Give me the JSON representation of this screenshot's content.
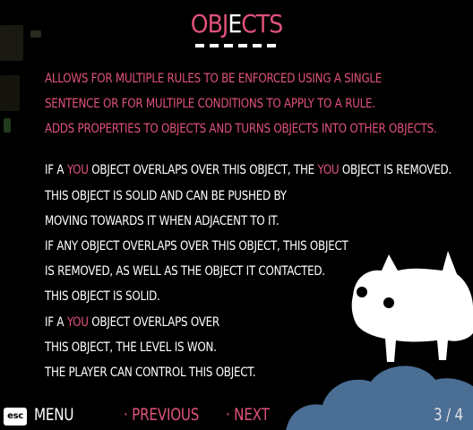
{
  "title": {
    "left": "OBJ",
    "highlight": "E",
    "right": "CTS"
  },
  "intro_lines": [
    "ALLOWS FOR MULTIPLE RULES TO BE ENFORCED USING A SINGLE",
    "SENTENCE OR FOR MULTIPLE CONDITIONS TO APPLY TO A RULE.",
    "ADDS PROPERTIES TO OBJECTS AND TURNS OBJECTS INTO OTHER OBJECTS."
  ],
  "descriptions": {
    "l1a": "IF A ",
    "l1b": "YOU",
    "l1c": " OBJECT OVERLAPS OVER THIS OBJECT, THE ",
    "l1d": "YOU",
    "l1e": " OBJECT IS REMOVED.",
    "l2": "THIS OBJECT IS SOLID AND CAN BE PUSHED BY",
    "l3": "MOVING TOWARDS IT WHEN ADJACENT TO IT.",
    "l4": "IF ANY OBJECT OVERLAPS OVER THIS OBJECT, THIS OBJECT",
    "l5": "IS REMOVED, AS WELL AS THE OBJECT IT CONTACTED.",
    "l6": "THIS OBJECT IS SOLID.",
    "l7a": "IF A ",
    "l7b": "YOU",
    "l7c": " OBJECT OVERLAPS OVER",
    "l8": "THIS OBJECT, THE LEVEL IS WON.",
    "l9": "THE PLAYER CAN CONTROL THIS OBJECT."
  },
  "footer": {
    "esc_label": "esc",
    "menu_label": "MENU",
    "previous_label": "· PREVIOUS",
    "next_label": "· NEXT",
    "page_indicator": "3 / 4"
  },
  "colors": {
    "accent": "#e0527a",
    "text": "#ffffff",
    "background": "#000000",
    "cloud": "#4a6e94"
  }
}
